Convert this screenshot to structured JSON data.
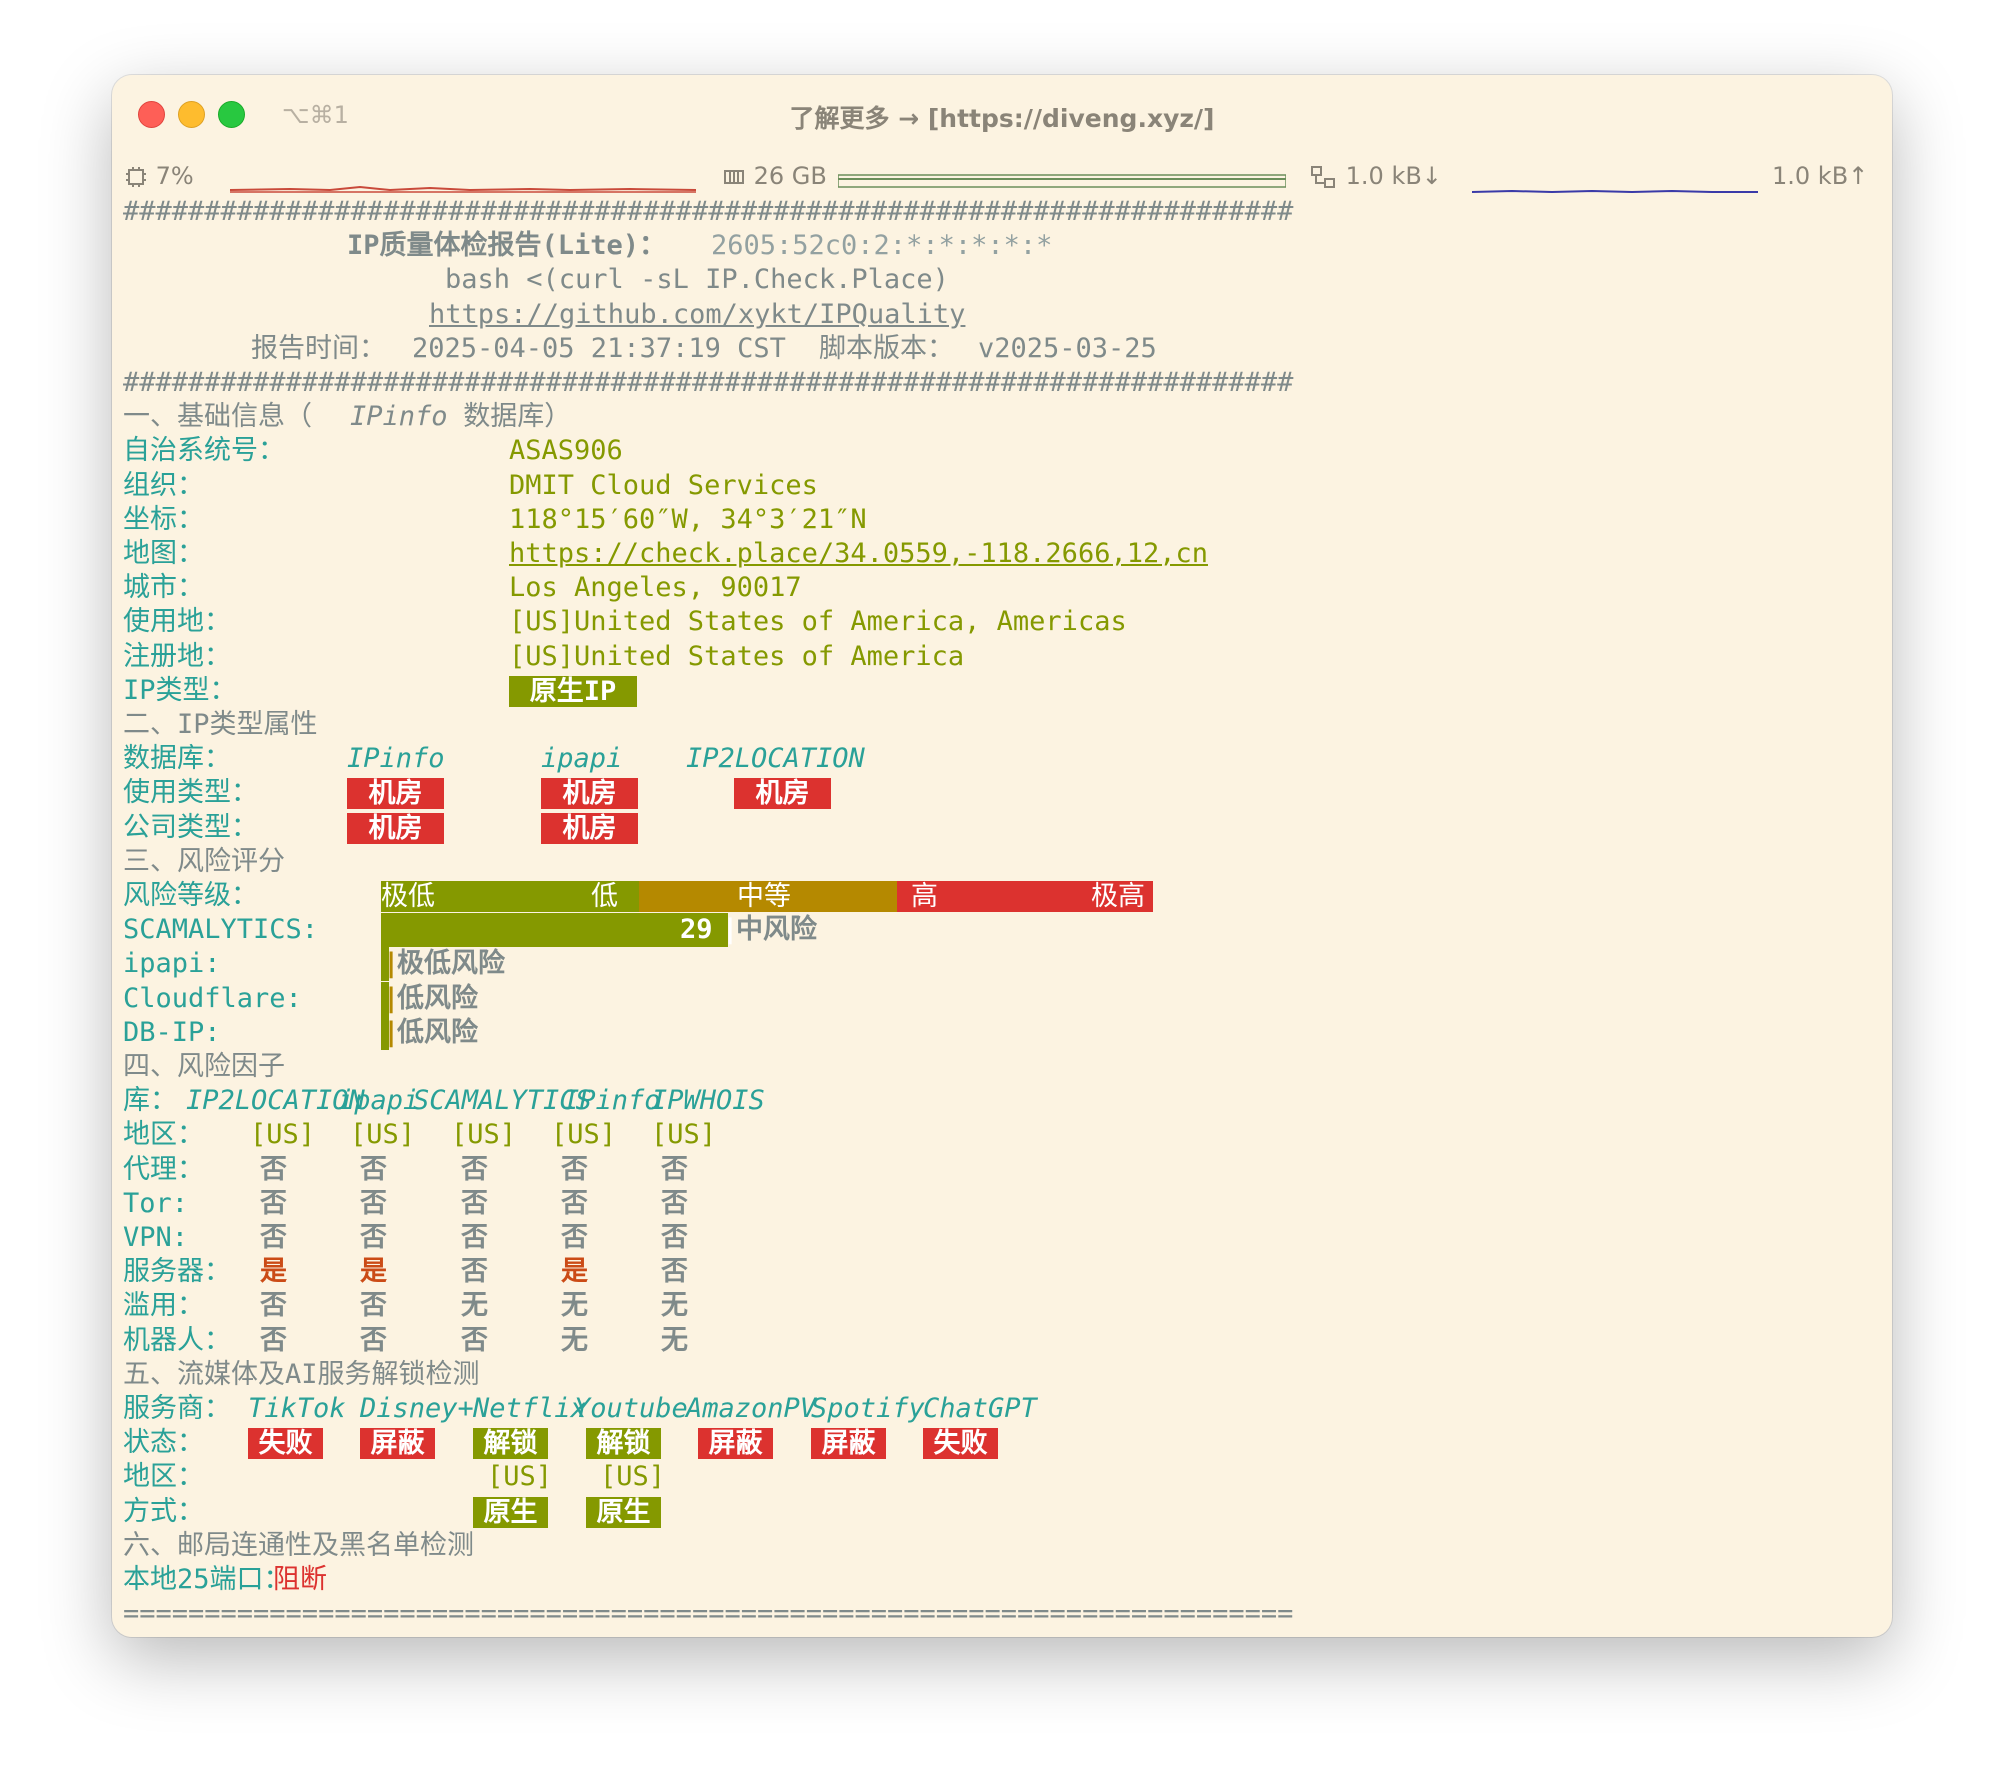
{
  "window": {
    "shortcut": "⌥⌘1",
    "title": "了解更多 → [https://diveng.xyz/]"
  },
  "statusbar": {
    "cpu": "7%",
    "mem": "26 GB",
    "net_down": "1.0 kB↓",
    "net_up": "1.0 kB↑"
  },
  "report": {
    "hash_line": "########################################################################",
    "eq_line": "========================================================================",
    "title": "IP质量体检报告(Lite)：",
    "ip": "2605:52c0:2:*:*:*:*:*",
    "cmd": "bash <(curl -sL IP.Check.Place)",
    "repo": "https://github.com/xykt/IPQuality",
    "time_label": "报告时间：",
    "time": "2025-04-05 21:37:19 CST",
    "ver_label": "脚本版本：",
    "ver": "v2025-03-25"
  },
  "s1": {
    "heading": "一、基础信息（",
    "heading_db": "IPinfo",
    "heading_end": " 数据库）",
    "rows": [
      {
        "label": "自治系统号：",
        "value": "ASAS906"
      },
      {
        "label": "组织：",
        "value": "DMIT Cloud Services"
      },
      {
        "label": "坐标：",
        "value": "118°15′60″W, 34°3′21″N"
      },
      {
        "label": "地图：",
        "value": "https://check.place/34.0559,-118.2666,12,cn"
      },
      {
        "label": "城市：",
        "value": "Los Angeles, 90017"
      },
      {
        "label": "使用地：",
        "value": "[US]United States of America, Americas"
      },
      {
        "label": "注册地：",
        "value": "[US]United States of America"
      }
    ],
    "type_label": "IP类型：",
    "type_value": "原生IP"
  },
  "s2": {
    "heading": "二、IP类型属性",
    "db_label": "数据库：",
    "dbs": [
      "IPinfo",
      "ipapi",
      "IP2LOCATION"
    ],
    "usage_label": "使用类型：",
    "usage": [
      "机房",
      "机房",
      "机房"
    ],
    "company_label": "公司类型：",
    "company": [
      "机房",
      "机房"
    ]
  },
  "s3": {
    "heading": "三、风险评分",
    "level_label": "风险等级：",
    "levels": [
      "极低",
      "低",
      "中等",
      "高",
      "极高"
    ],
    "rows": [
      {
        "label": "SCAMALYTICS:",
        "score": "29",
        "text": "中风险",
        "fraction": 0.29
      },
      {
        "label": "ipapi:",
        "score": "",
        "text": "极低风险",
        "fraction": 0.0
      },
      {
        "label": "Cloudflare:",
        "score": "",
        "text": "低风险",
        "fraction": 0.0
      },
      {
        "label": "DB-IP:",
        "score": "",
        "text": "低风险",
        "fraction": 0.0
      }
    ]
  },
  "s4": {
    "heading": "四、风险因子",
    "lib_label": "库：",
    "libs": [
      "IP2LOCATION",
      "ipapi",
      "SCAMALYTICS",
      "IPinfo",
      "IPWHOIS"
    ],
    "region_label": "地区：",
    "regions": [
      "[US]",
      "[US]",
      "[US]",
      "[US]",
      "[US]"
    ],
    "rows": [
      {
        "label": "代理：",
        "vals": [
          "否",
          "否",
          "否",
          "否",
          "否"
        ]
      },
      {
        "label": "Tor:",
        "vals": [
          "否",
          "否",
          "否",
          "否",
          "否"
        ]
      },
      {
        "label": "VPN:",
        "vals": [
          "否",
          "否",
          "否",
          "否",
          "否"
        ]
      },
      {
        "label": "服务器：",
        "vals": [
          "是",
          "是",
          "否",
          "是",
          "否"
        ]
      },
      {
        "label": "滥用：",
        "vals": [
          "否",
          "否",
          "无",
          "无",
          "无"
        ]
      },
      {
        "label": "机器人：",
        "vals": [
          "否",
          "否",
          "否",
          "无",
          "无"
        ]
      }
    ]
  },
  "s5": {
    "heading": "五、流媒体及AI服务解锁检测",
    "provider_label": "服务商：",
    "providers": [
      "TikTok",
      "Disney+",
      "Netflix",
      "Youtube",
      "AmazonPV",
      "Spotify",
      "ChatGPT"
    ],
    "status_label": "状态：",
    "status": [
      "失败",
      "屏蔽",
      "解锁",
      "解锁",
      "屏蔽",
      "屏蔽",
      "失败"
    ],
    "region_label": "地区：",
    "regions": [
      "",
      "",
      "[US]",
      "[US]",
      "",
      "",
      ""
    ],
    "mode_label": "方式：",
    "modes": [
      "",
      "",
      "原生",
      "原生",
      "",
      "",
      ""
    ]
  },
  "s6": {
    "heading": "六、邮局连通性及黑名单检测",
    "port_label": "本地25端口：",
    "port_value": "阻断"
  },
  "colors": {
    "bg": "#fcf3e1",
    "green": "#859900",
    "red": "#dc322f",
    "orange": "#b58900",
    "cyan": "#2aa198"
  }
}
